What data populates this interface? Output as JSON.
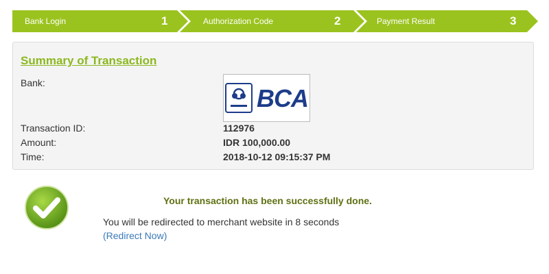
{
  "steps": [
    {
      "label": "Bank Login",
      "number": "1"
    },
    {
      "label": "Authorization Code",
      "number": "2"
    },
    {
      "label": "Payment Result",
      "number": "3"
    }
  ],
  "summary": {
    "title": "Summary of Transaction",
    "bank_label": "Bank:",
    "bank_logo_text": "BCA",
    "transaction_id_label": "Transaction ID:",
    "transaction_id": "112976",
    "amount_label": "Amount:",
    "amount": "IDR 100,000.00",
    "time_label": "Time:",
    "time": "2018-10-12 09:15:37 PM"
  },
  "result": {
    "success_message": "Your transaction has been successfully done.",
    "redirect_message": "You will be redirected to merchant website in 8 seconds",
    "redirect_link": "(Redirect Now)"
  },
  "colors": {
    "step_bar": "#9bc31f",
    "title_green": "#8cb81f",
    "success_text": "#5e7012",
    "link_blue": "#3a79b9",
    "bca_blue": "#1d3c8a"
  },
  "icons": {
    "success": "check-circle-icon"
  }
}
